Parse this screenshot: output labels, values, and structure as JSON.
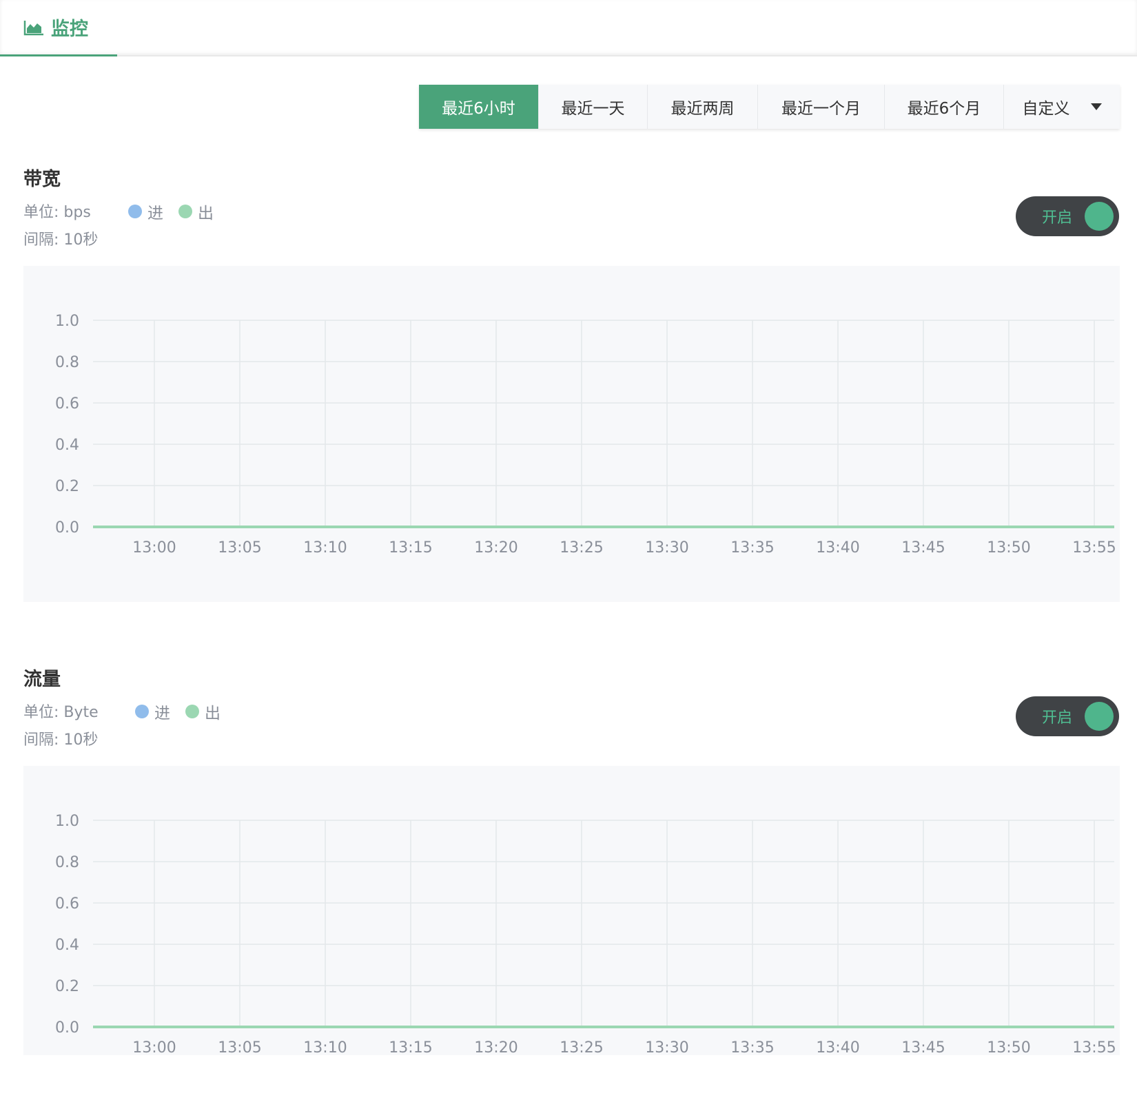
{
  "tab": {
    "label": "监控",
    "icon": "area-chart-icon"
  },
  "time_ranges": [
    {
      "label": "最近6小时",
      "active": true
    },
    {
      "label": "最近一天",
      "active": false
    },
    {
      "label": "最近两周",
      "active": false
    },
    {
      "label": "最近一个月",
      "active": false
    },
    {
      "label": "最近6个月",
      "active": false
    },
    {
      "label": "自定义",
      "active": false
    }
  ],
  "legend": {
    "in": "进",
    "out": "出"
  },
  "colors": {
    "accent": "#4aa37a",
    "in": "#90bceb",
    "out": "#9bd7b2"
  },
  "sections": [
    {
      "title": "带宽",
      "unit": "单位: bps",
      "interval": "间隔: 10秒",
      "toggle_label": "开启"
    },
    {
      "title": "流量",
      "unit": "单位: Byte",
      "interval": "间隔: 10秒",
      "toggle_label": "开启"
    }
  ],
  "chart_data": [
    {
      "type": "line",
      "x": [
        "13:00",
        "13:05",
        "13:10",
        "13:15",
        "13:20",
        "13:25",
        "13:30",
        "13:35",
        "13:40",
        "13:45",
        "13:50",
        "13:55"
      ],
      "yticks": [
        "0.0",
        "0.2",
        "0.4",
        "0.6",
        "0.8",
        "1.0"
      ],
      "ylim": [
        0,
        1
      ],
      "series": [
        {
          "name": "进",
          "values": [
            0,
            0,
            0,
            0,
            0,
            0,
            0,
            0,
            0,
            0,
            0,
            0
          ]
        },
        {
          "name": "出",
          "values": [
            0,
            0,
            0,
            0,
            0,
            0,
            0,
            0,
            0,
            0,
            0,
            0
          ]
        }
      ],
      "grid": true
    },
    {
      "type": "line",
      "x": [
        "13:00",
        "13:05",
        "13:10",
        "13:15",
        "13:20",
        "13:25",
        "13:30",
        "13:35",
        "13:40",
        "13:45",
        "13:50",
        "13:55"
      ],
      "yticks": [
        "0.0",
        "0.2",
        "0.4",
        "0.6",
        "0.8",
        "1.0"
      ],
      "ylim": [
        0,
        1
      ],
      "series": [
        {
          "name": "进",
          "values": [
            0,
            0,
            0,
            0,
            0,
            0,
            0,
            0,
            0,
            0,
            0,
            0
          ]
        },
        {
          "name": "出",
          "values": [
            0,
            0,
            0,
            0,
            0,
            0,
            0,
            0,
            0,
            0,
            0,
            0
          ]
        }
      ],
      "grid": true
    }
  ]
}
